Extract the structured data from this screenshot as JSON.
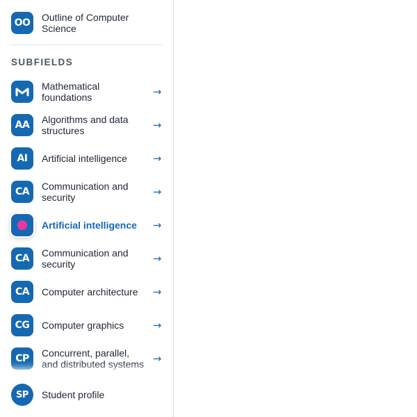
{
  "overview": {
    "badge": "OO",
    "label": "Outline of Computer Science"
  },
  "section_label": "SUBFIELDS",
  "subfields": [
    {
      "badge": "M",
      "label": "Mathematical foundations",
      "icon": "m-logo-icon"
    },
    {
      "badge": "AA",
      "label": "Algorithms and data structures"
    },
    {
      "badge": "AI",
      "label": "Artificial intelligence"
    },
    {
      "badge": "CA",
      "label": "Communication and security"
    },
    {
      "badge": "",
      "label": "Artificial intelligence",
      "active": true
    },
    {
      "badge": "CA",
      "label": "Communication and security"
    },
    {
      "badge": "CA",
      "label": "Computer architecture"
    },
    {
      "badge": "CG",
      "label": "Computer graphics"
    },
    {
      "badge": "CP",
      "label": "Concurrent, parallel, and distributed systems"
    }
  ],
  "arrow": "→",
  "footer": {
    "badge": "SP",
    "label": "Student profile"
  },
  "colors": {
    "accent": "#1569b3",
    "active_dot": "#e8399a",
    "text": "#1f2733",
    "muted": "#4a5565"
  }
}
